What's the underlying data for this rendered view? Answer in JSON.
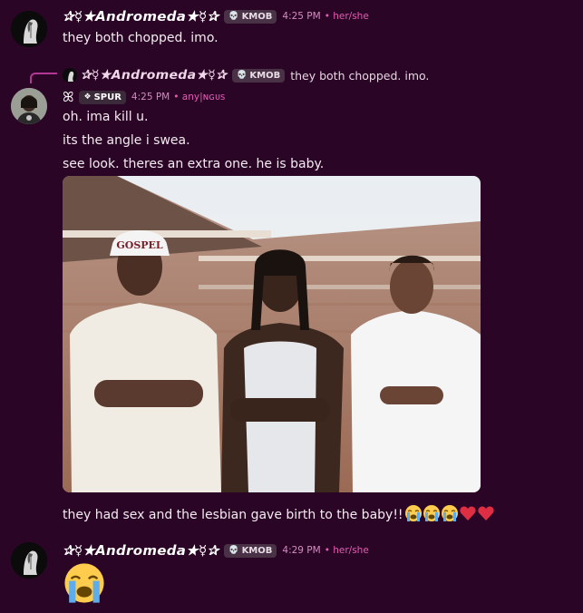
{
  "messages": [
    {
      "username": "✰☿★𝘼𝙣𝙙𝙧𝙤𝙢𝙚𝙙𝙖★☿✰",
      "tag": "KMOB",
      "tag_icon": "skull-icon",
      "time": "4:25 PM",
      "pronouns": "• her/she",
      "text": "they both chopped. imo."
    },
    {
      "reply": {
        "username": "✰☿★𝘼𝙣𝙙𝙧𝙤𝙢𝙚𝙙𝙖★☿✰",
        "tag": "KMOB",
        "text": "they both chopped. imo."
      },
      "clover": "ꕤ",
      "tag": "SPUR",
      "tag_icon": "diamond-icon",
      "time": "4:25 PM",
      "pronouns": "• any|ɴɢᴜꜱ",
      "lines": [
        "oh. ima kill u.",
        "its the angle i swea.",
        "see look. theres an extra one. he is baby."
      ],
      "photo": {
        "hat_text": "GOSPEL"
      },
      "caption": "they had sex and the lesbian gave birth to the baby!!"
    },
    {
      "username": "✰☿★𝘼𝙣𝙙𝙧𝙤𝙢𝙚𝙙𝙖★☿✰",
      "tag": "KMOB",
      "tag_icon": "skull-icon",
      "time": "4:29 PM",
      "pronouns": "• her/she"
    }
  ],
  "colors": {
    "background": "#2a0525",
    "timestamp": "#d68ac4",
    "pronouns": "#e65ab5",
    "reply_spine": "#b23893"
  }
}
